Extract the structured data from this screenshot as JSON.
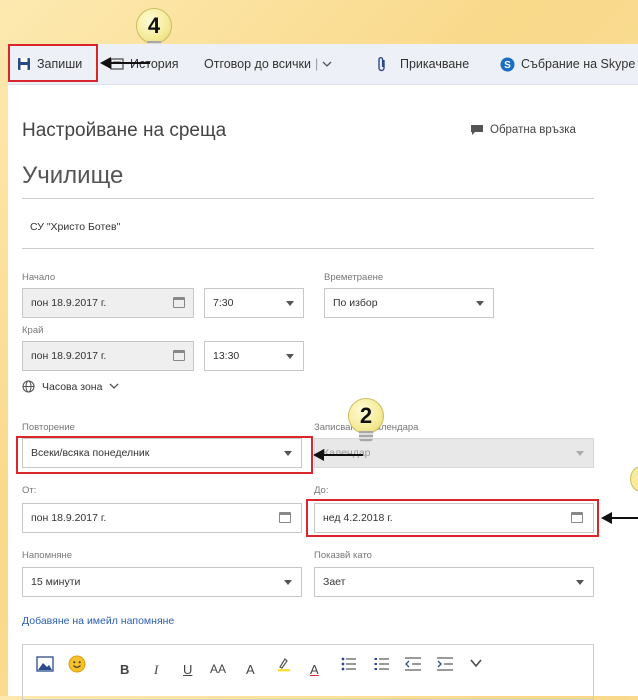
{
  "toolbar": {
    "save_label": "Запиши",
    "history_label": "История",
    "reply_all_label": "Отговор до всички",
    "reply_divider": "|",
    "attach_label": "Прикачване",
    "skype_label": "Събрание на Skype"
  },
  "header": {
    "title": "Настройване на среща",
    "feedback_label": "Обратна връзка"
  },
  "event": {
    "subject": "Училище",
    "location": "СУ \"Христо Ботев\""
  },
  "start": {
    "label": "Начало",
    "date": "пон 18.9.2017 г.",
    "time": "7:30"
  },
  "duration": {
    "label": "Времетраене",
    "value": "По избор"
  },
  "end": {
    "label": "Край",
    "date": "пон 18.9.2017 г.",
    "time": "13:30"
  },
  "timezone_label": "Часова зона",
  "repeat": {
    "label": "Повторение",
    "value": "Всеки/всяка понеделник"
  },
  "save_to_calendar": {
    "label": "Записване в календара",
    "value": "Календар"
  },
  "from": {
    "label": "От:",
    "value": "пон 18.9.2017 г."
  },
  "to": {
    "label": "До:",
    "value": "нед 4.2.2018 г."
  },
  "reminder": {
    "label": "Напомняне",
    "value": "15 минути"
  },
  "show_as": {
    "label": "Показвй като",
    "value": "Зает"
  },
  "add_email_reminder": "Добавяне на имейл напомняне",
  "callouts": {
    "step_4": "4",
    "step_2": "2"
  },
  "format_toolbar": {
    "bold": "B",
    "italic": "I",
    "underline": "U",
    "font_size": "AA",
    "grow": "A",
    "font_color": "A"
  },
  "colors": {
    "toolbar_bg": "#eef0f7",
    "callout_red": "#d9262c",
    "link_blue": "#2b5fb3",
    "save_icon": "#2b4a8a"
  }
}
